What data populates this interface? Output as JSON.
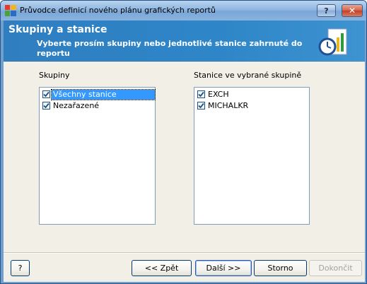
{
  "window": {
    "title": "Průvodce definicí nového plánu grafických reportů",
    "help_glyph": "?",
    "close_glyph": "✕"
  },
  "header": {
    "title": "Skupiny a stanice",
    "subtitle": "Vyberte prosím skupiny nebo jednotlivé stanice zahrnuté do reportu"
  },
  "groups": {
    "label": "Skupiny",
    "items": [
      {
        "label": "Všechny stanice",
        "checked": true,
        "selected": true
      },
      {
        "label": "Nezařazené",
        "checked": true,
        "selected": false
      }
    ]
  },
  "stations": {
    "label": "Stanice ve vybrané skupině",
    "items": [
      {
        "label": "EXCH",
        "checked": true
      },
      {
        "label": "MICHALKR",
        "checked": true
      }
    ]
  },
  "buttons": {
    "help": "?",
    "back": "<< Zpět",
    "next": "Další >>",
    "cancel": "Storno",
    "finish": "Dokončit"
  },
  "colors": {
    "header_band": "#2e86c8",
    "selection": "#3399ff",
    "dialog_bg": "#f1efe6"
  }
}
